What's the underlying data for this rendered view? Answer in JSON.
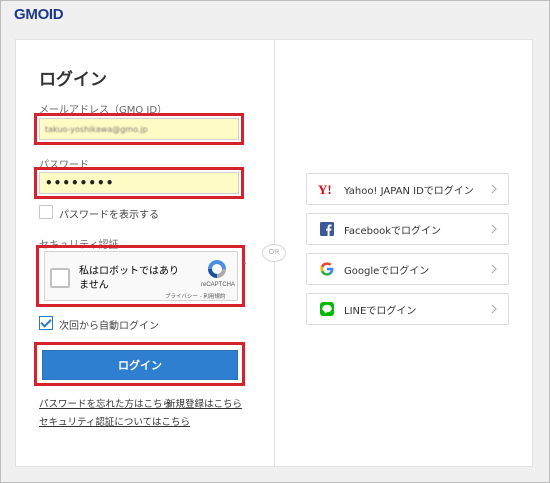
{
  "brand": {
    "logo_text": "GMOID"
  },
  "login": {
    "title": "ログイン",
    "email_label": "メールアドレス（GMO ID）",
    "email_value": "takuo-yoshikawa@gmo.jp",
    "password_label": "パスワード",
    "password_value": "••••••••",
    "show_password_label": "パスワードを表示する",
    "security_label": "セキュリティ認証",
    "recaptcha_text": "私はロボットではありません",
    "recaptcha_brand": "reCAPTCHA",
    "recaptcha_terms": "プライバシー - 利用規約",
    "auto_login_label": "次回から自動ログイン",
    "submit_label": "ログイン",
    "forgot_password_link": "パスワードを忘れた方はこちら",
    "signup_link": "新規登録はこちら",
    "security_info_link": "セキュリティ認証についてはこちら"
  },
  "divider": {
    "or_text": "OR"
  },
  "social": [
    {
      "label": "Yahoo! JAPAN IDでログイン",
      "icon": "yahoo-icon"
    },
    {
      "label": "Facebookでログイン",
      "icon": "facebook-icon"
    },
    {
      "label": "Googleでログイン",
      "icon": "google-icon"
    },
    {
      "label": "LINEでログイン",
      "icon": "line-icon"
    }
  ],
  "colors": {
    "accent": "#2e7fd0",
    "highlight_red": "#d6222d",
    "input_fill": "#fffbc4",
    "brand_blue": "#1b3a8a"
  }
}
